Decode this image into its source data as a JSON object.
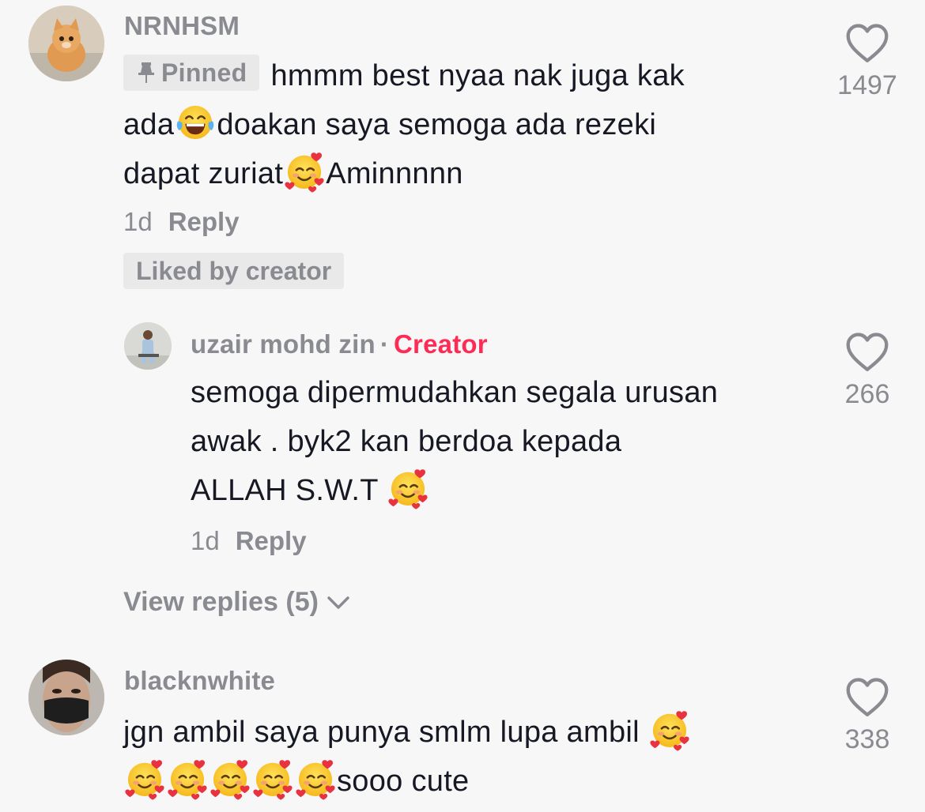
{
  "comments": [
    {
      "username": "NRNHSM",
      "pinned_label": "Pinned",
      "text_parts": [
        "hmmm best nyaa nak juga kak",
        "ada",
        "doakan saya semoga ada rezeki",
        "dapat zuriat",
        "Aminnnnn"
      ],
      "time": "1d",
      "reply_label": "Reply",
      "liked_by_label": "Liked by creator",
      "likes": "1497",
      "avatar_icon": "kitten-avatar"
    },
    {
      "username": "uzair mohd zin",
      "separator": "·",
      "creator_label": "Creator",
      "text_lines": [
        "semoga dipermudahkan segala urusan",
        "awak . byk2 kan berdoa kepada",
        "ALLAH S.W.T"
      ],
      "time": "1d",
      "reply_label": "Reply",
      "likes": "266",
      "avatar_icon": "person-avatar"
    },
    {
      "username": "blacknwhite",
      "text_lines": [
        "jgn ambil saya punya smlm lupa ambil",
        "sooo cute"
      ],
      "likes": "338",
      "avatar_icon": "masked-person-avatar"
    }
  ],
  "view_replies_label": "View replies (5)",
  "icons": {
    "like": "heart-outline-icon",
    "pin": "pin-icon",
    "chevron": "chevron-down-icon",
    "emoji_laugh": "tears-of-joy-emoji",
    "emoji_love": "smiling-face-with-hearts-emoji"
  },
  "colors": {
    "background": "#f7f7f7",
    "text": "#161823",
    "muted": "#8a8b91",
    "creator": "#fe2c55",
    "badge_bg": "#e9e9ea"
  }
}
